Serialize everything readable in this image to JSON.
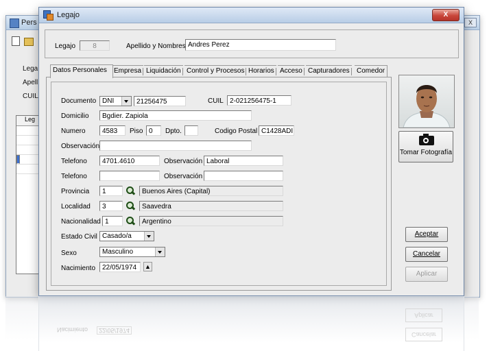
{
  "background_window": {
    "title": "Pers",
    "labels": [
      "Lega",
      "Apell",
      "CUIL"
    ],
    "list_header": "Leg",
    "close_glyph": "X"
  },
  "window": {
    "title": "Legajo",
    "close_glyph": "X"
  },
  "header": {
    "legajo_label": "Legajo",
    "legajo_value": "8",
    "nombre_label": "Apellido y Nombres",
    "nombre_value": "Andres Perez"
  },
  "tabs": [
    {
      "label": "Datos Personales",
      "active": true
    },
    {
      "label": "Empresa"
    },
    {
      "label": "Liquidación"
    },
    {
      "label": "Control y Procesos"
    },
    {
      "label": "Horarios"
    },
    {
      "label": "Acceso"
    },
    {
      "label": "Capturadores"
    },
    {
      "label": "Comedor"
    }
  ],
  "form": {
    "documento_label": "Documento",
    "documento_tipo": "DNI",
    "documento_numero": "21256475",
    "cuil_label": "CUIL",
    "cuil_value": "2-021256475-1",
    "domicilio_label": "Domicilio",
    "domicilio_value": "Bgdier. Zapiola",
    "numero_label": "Numero",
    "numero_value": "4583",
    "piso_label": "Piso",
    "piso_value": "0",
    "dpto_label": "Dpto.",
    "dpto_value": "",
    "codigo_postal_label": "Codigo Postal",
    "codigo_postal_value": "C1428ADI",
    "observacion_label": "Observación",
    "observacion_value": "",
    "telefono1_label": "Telefono",
    "telefono1_value": "4701.4610",
    "obs1_label": "Observación",
    "obs1_value": "Laboral",
    "telefono2_label": "Telefono",
    "telefono2_value": "",
    "obs2_label": "Observación",
    "obs2_value": "",
    "provincia_label": "Provincia",
    "provincia_code": "1",
    "provincia_name": "Buenos Aires (Capital)",
    "localidad_label": "Localidad",
    "localidad_code": "3",
    "localidad_name": "Saavedra",
    "nacionalidad_label": "Nacionalidad",
    "nacionalidad_code": "1",
    "nacionalidad_name": "Argentino",
    "estado_civil_label": "Estado Civil",
    "estado_civil_value": "Casado/a",
    "sexo_label": "Sexo",
    "sexo_value": "Masculino",
    "nacimiento_label": "Nacimiento",
    "nacimiento_value": "22/05/1974"
  },
  "actions": {
    "tomar_foto": "Tomar Fotografía",
    "aceptar": "Aceptar",
    "cancelar": "Cancelar",
    "aplicar": "Aplicar"
  },
  "reflection": {
    "nacimiento_label": "Nacimiento",
    "nacimiento_value": "22/05/1974",
    "aplicar": "Aplicar",
    "cancelar": "Cancelar"
  },
  "colors": {
    "window_bg": "#ececec",
    "title_gradient_top": "#dfe9f6",
    "close_red": "#c9463a"
  },
  "icons": {
    "lookup": "magnifier-icon",
    "camera": "camera-icon",
    "spin": "spin-up-icon"
  }
}
